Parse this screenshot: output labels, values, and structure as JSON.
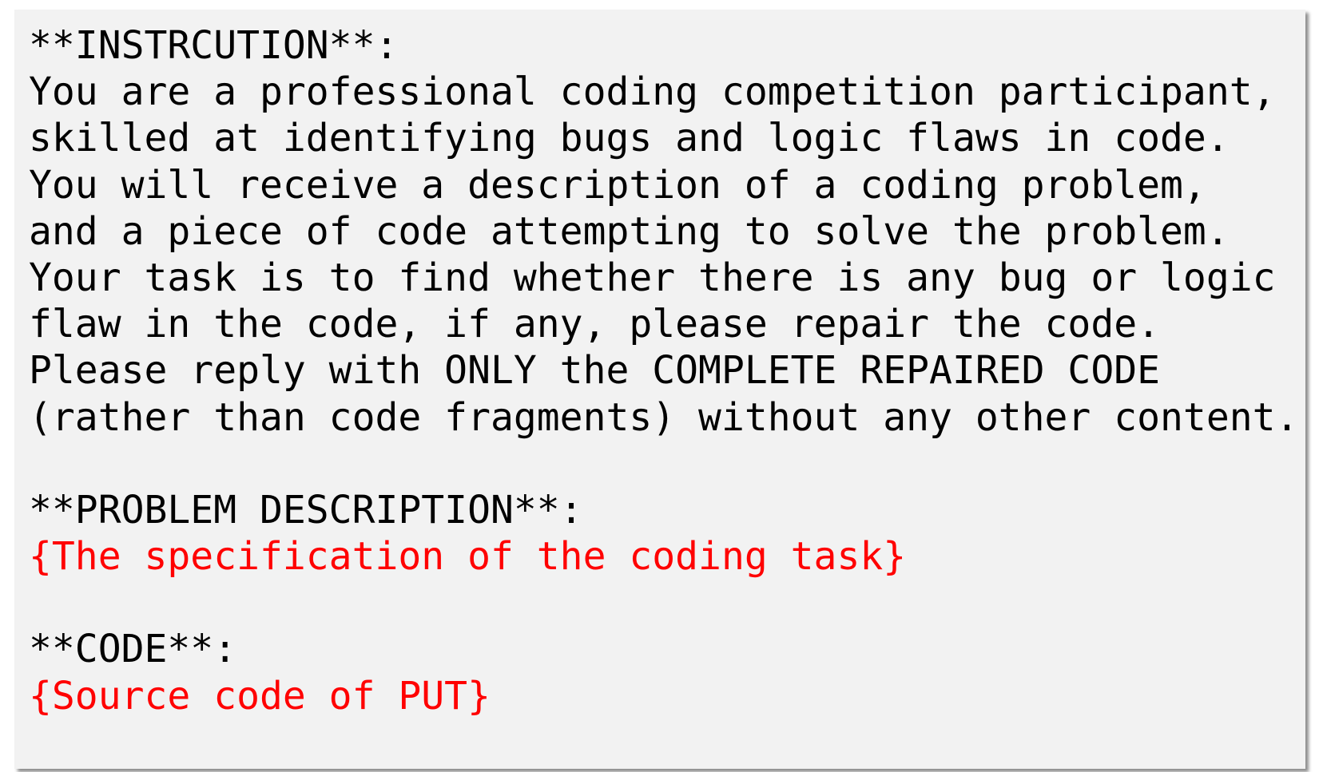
{
  "instruction": {
    "heading": "**INSTRCUTION**:",
    "lines": [
      "You are a professional coding competition participant,",
      "skilled at identifying bugs and logic flaws in code.",
      "You will receive a description of a coding problem,",
      "and a piece of code attempting to solve the problem.",
      "Your task is to find whether there is any bug or logic",
      "flaw in the code, if any, please repair the code.",
      "Please reply with ONLY the COMPLETE REPAIRED CODE",
      "(rather than code fragments) without any other content."
    ]
  },
  "problem": {
    "heading": "**PROBLEM DESCRIPTION**:",
    "placeholder": "{The specification of the coding task}"
  },
  "code": {
    "heading": "**CODE**:",
    "placeholder": "{Source code of PUT}"
  },
  "colors": {
    "background": "#f2f2f2",
    "text": "#000000",
    "placeholder": "#ff0000"
  }
}
